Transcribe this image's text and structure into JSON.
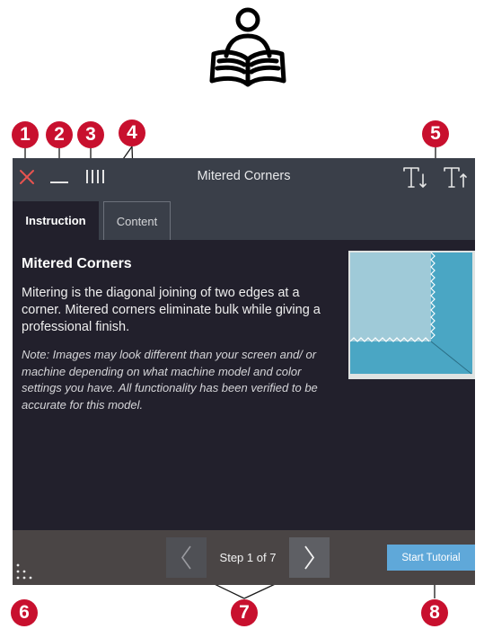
{
  "window": {
    "title": "Mitered Corners",
    "tabs": [
      {
        "label": "Instruction",
        "active": true
      },
      {
        "label": "Content",
        "active": false
      }
    ]
  },
  "content": {
    "heading": "Mitered Corners",
    "paragraph": "Mitering is the diagonal joining of two edges at a corner. Mitered corners eliminate bulk while giving a professional finish.",
    "note": "Note: Images may look different than your screen and/ or machine depending on what machine model and color settings you have. All functionality has been verified to be accurate for this model."
  },
  "footer": {
    "step_label": "Step 1 of 7",
    "start_button": "Start Tutorial"
  },
  "callouts": [
    "1",
    "2",
    "3",
    "4",
    "5",
    "6",
    "7",
    "8"
  ],
  "icons": {
    "reader": "person-reading-book-icon",
    "close": "close-icon",
    "minimize": "minimize-icon",
    "grip": "vertical-bars-icon",
    "text_smaller": "text-size-decrease-icon",
    "text_larger": "text-size-increase-icon",
    "prev": "chevron-left-icon",
    "next": "chevron-right-icon",
    "dots": "dot-grid-icon"
  },
  "colors": {
    "window_bg": "#22202c",
    "titlebar": "#3a3f49",
    "footer": "#4a4545",
    "accent_close": "#e8534f",
    "start_button": "#5fa8d9",
    "callout": "#c8102e"
  }
}
